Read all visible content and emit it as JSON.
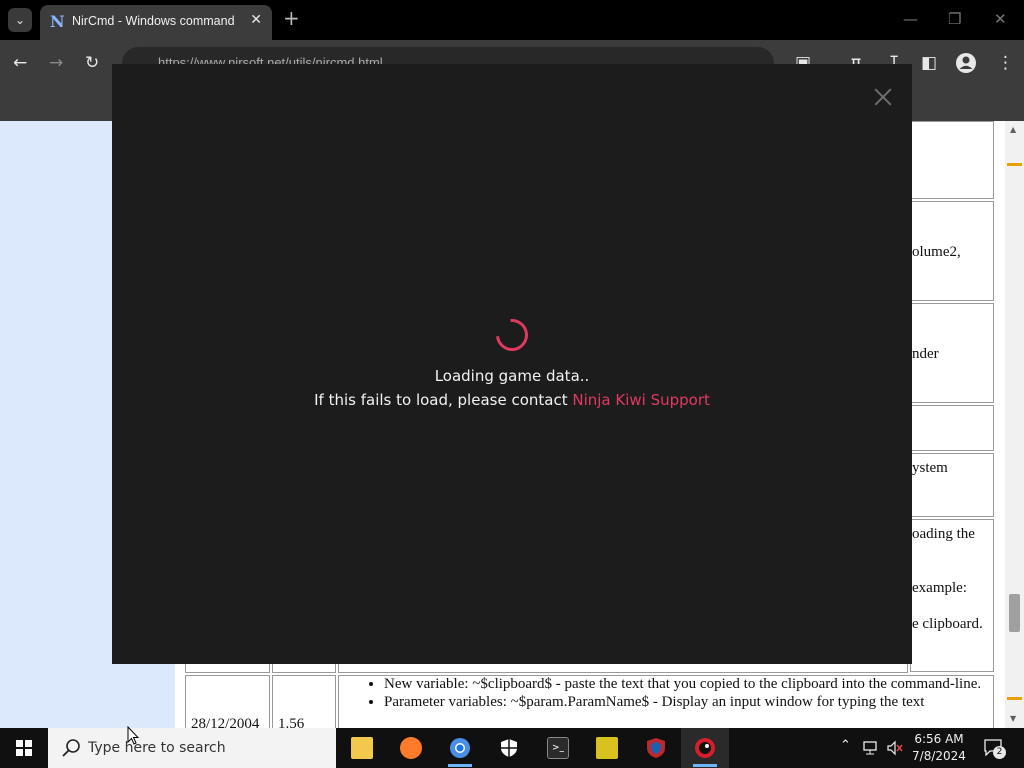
{
  "browser": {
    "tab_title": "NirCmd - Windows command",
    "tab_favicon": "N",
    "url": "https://www.nirsoft.net/utils/nircmd.html"
  },
  "page": {
    "fragments": [
      "olume2,",
      "nder",
      "ystem",
      "oading the",
      "example:",
      "e clipboard."
    ],
    "row_date": "28/12/2004",
    "row_version": "1.56",
    "bullets": [
      "New variable: ~$clipboard$ - paste the text that you copied to the clipboard into the command-line.",
      "Parameter variables: ~$param.ParamName$ - Display an input window for typing the text"
    ]
  },
  "modal": {
    "loading_line": "Loading game data..",
    "contact_prefix": "If this fails to load, please contact ",
    "contact_link": "Ninja Kiwi Support",
    "accent_color": "#e0395f"
  },
  "taskbar": {
    "search_placeholder": "Type here to search",
    "apps": [
      "file-explorer-icon",
      "firefox-icon",
      "chrome-icon",
      "windows-security-icon",
      "terminal-icon",
      "file-manager-icon",
      "shield-app-icon",
      "bloons-game-icon"
    ],
    "notification_count": "2",
    "time": "6:56 AM",
    "date": "7/8/2024"
  }
}
